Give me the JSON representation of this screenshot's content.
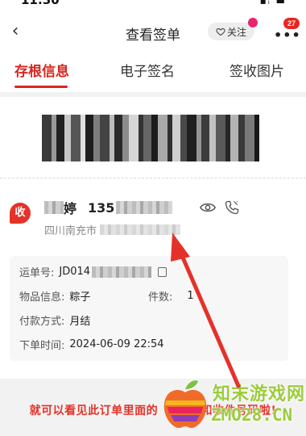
{
  "status_bar": {
    "time": "11:30",
    "indicators": "▪ᵢ ▬"
  },
  "nav": {
    "back_icon": "‹",
    "title": "查看签单",
    "follow_label": "关注",
    "more_icon": "•••",
    "more_badge": "27"
  },
  "tabs": [
    {
      "label": "存根信息",
      "active": true
    },
    {
      "label": "电子签名",
      "active": false
    },
    {
      "label": "签收图片",
      "active": false
    }
  ],
  "recipient": {
    "badge": "收",
    "name_visible": "婷",
    "phone_prefix": "135",
    "address_visible": "四川南充市"
  },
  "details": {
    "waybill_label": "运单号:",
    "waybill_value": "JD014",
    "item_label": "物品信息:",
    "item_value": "粽子",
    "count_label": "件数:",
    "count_value": "1",
    "pay_label": "付款方式:",
    "pay_value": "月结",
    "time_label": "下单时间:",
    "time_value": "2024-06-09 22:54"
  },
  "caption": {
    "before": "就可以看见此订单里面的",
    "after": "和收件号码啦!"
  },
  "watermark": {
    "title": "知末游戏网",
    "url": "ZMO28.CN"
  },
  "colors": {
    "accent": "#d7261f",
    "watermark_green": "#9bcc3c"
  }
}
